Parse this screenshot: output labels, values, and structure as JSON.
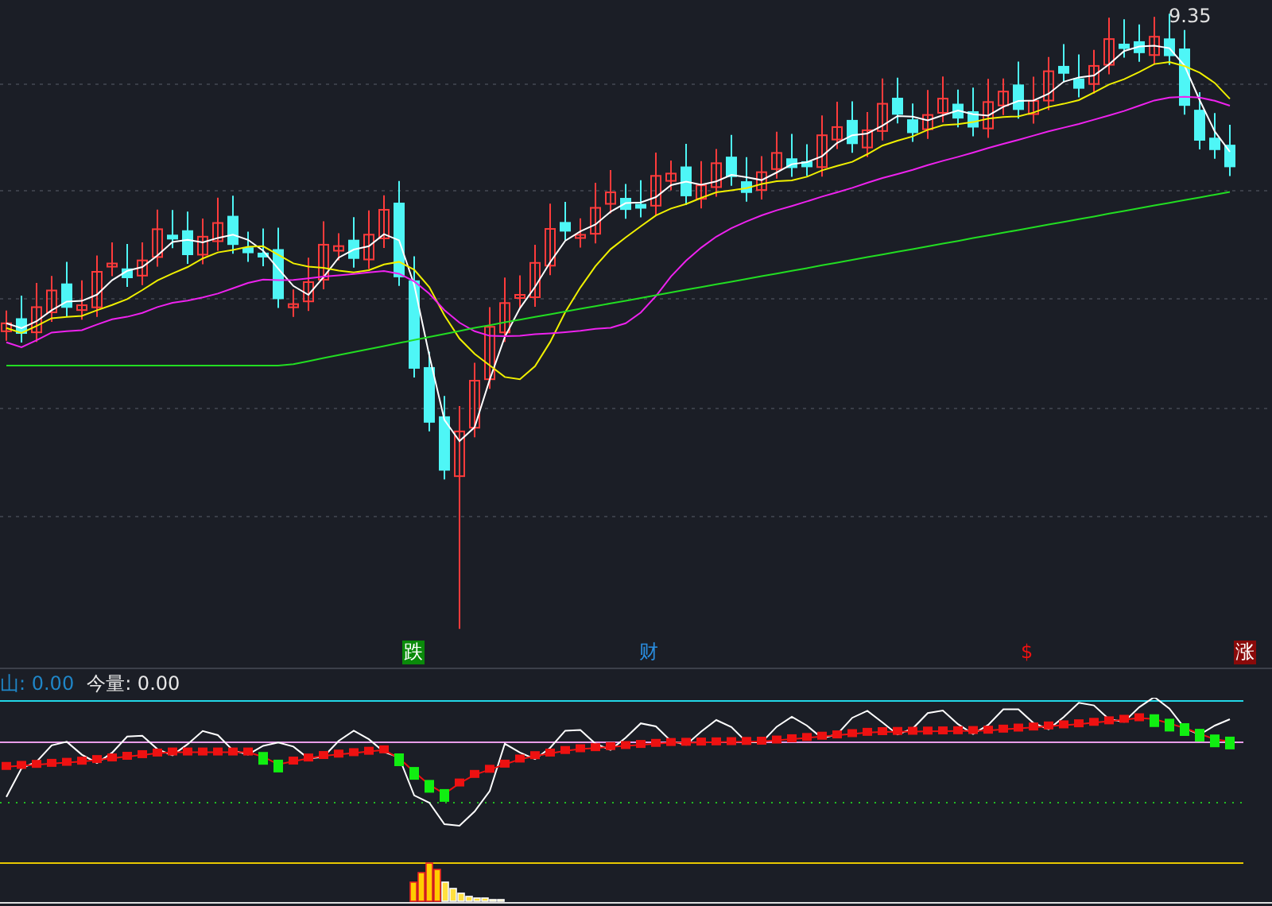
{
  "main_chart": {
    "price_label": "9.35"
  },
  "signals": [
    {
      "kind": "boxed",
      "text": "跌",
      "color": "#0a8a0a"
    },
    {
      "kind": "plain",
      "text": "财",
      "color": "#2a8ee0"
    },
    {
      "kind": "plain",
      "text": "$",
      "color": "#ee1111"
    },
    {
      "kind": "boxed",
      "text": "涨",
      "color": "#8a0a0a"
    }
  ],
  "indicator": {
    "readings": [
      {
        "text": "山: 0.00",
        "color": "#1f86c8"
      },
      {
        "text": "今量: 0.00",
        "color": "#e8e8e8"
      }
    ]
  }
}
